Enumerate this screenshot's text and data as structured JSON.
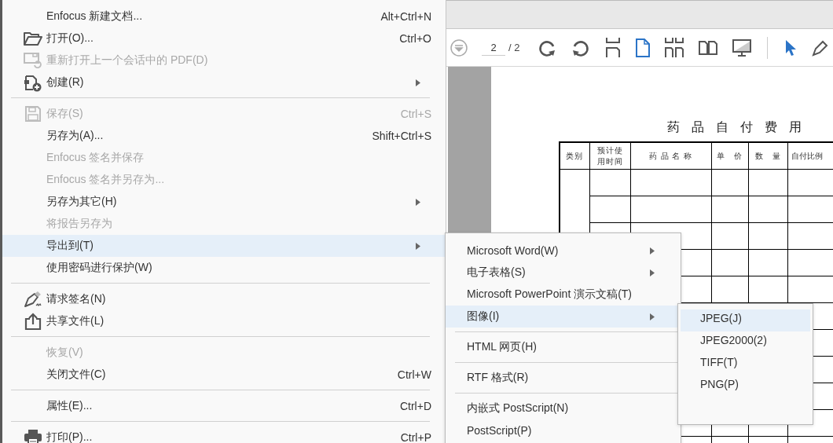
{
  "toolbar": {
    "tools": [
      {
        "kind": "scroll",
        "selected": false
      },
      {
        "kind": "page-field",
        "value": "2",
        "total": "/ 2"
      },
      {
        "kind": "rotate-cw",
        "selected": false
      },
      {
        "kind": "rotate-ccw",
        "selected": false
      },
      {
        "kind": "split",
        "selected": false
      },
      {
        "kind": "single-page",
        "selected": true
      },
      {
        "kind": "grid-pages",
        "selected": false
      },
      {
        "kind": "two-pages",
        "selected": false
      },
      {
        "kind": "monitor",
        "selected": false
      },
      {
        "kind": "divider"
      },
      {
        "kind": "cursor",
        "selected": true
      },
      {
        "kind": "pen",
        "selected": false
      }
    ]
  },
  "document": {
    "title": "药 品 自 付 费 用",
    "columns": [
      "类别",
      "预计使用时间",
      "药 品 名 称",
      "单　价",
      "数　量",
      "自付比例"
    ]
  },
  "file_menu": {
    "items": [
      {
        "kind": "item",
        "label": "Enfocus 新建文档...",
        "shortcut": "Alt+Ctrl+N",
        "disabled": false,
        "submenu": false,
        "selected": false
      },
      {
        "kind": "item",
        "label": "打开(O)...",
        "shortcut": "Ctrl+O",
        "disabled": false,
        "submenu": false,
        "selected": false
      },
      {
        "kind": "item",
        "label": "重新打开上一个会话中的 PDF(D)",
        "disabled": true,
        "submenu": false,
        "selected": false
      },
      {
        "kind": "item",
        "label": "创建(R)",
        "disabled": false,
        "submenu": true,
        "selected": false
      },
      {
        "kind": "separator"
      },
      {
        "kind": "item",
        "label": "保存(S)",
        "shortcut": "Ctrl+S",
        "disabled": true,
        "submenu": false,
        "selected": false
      },
      {
        "kind": "item",
        "label": "另存为(A)...",
        "shortcut": "Shift+Ctrl+S",
        "disabled": false,
        "submenu": false,
        "selected": false
      },
      {
        "kind": "item",
        "label": "Enfocus 签名并保存",
        "disabled": true,
        "submenu": false,
        "selected": false
      },
      {
        "kind": "item",
        "label": "Enfocus 签名并另存为...",
        "disabled": true,
        "submenu": false,
        "selected": false
      },
      {
        "kind": "item",
        "label": "另存为其它(H)",
        "disabled": false,
        "submenu": true,
        "selected": false
      },
      {
        "kind": "item",
        "label": "将报告另存为",
        "disabled": true,
        "submenu": false,
        "selected": false
      },
      {
        "kind": "item",
        "label": "导出到(T)",
        "disabled": false,
        "submenu": true,
        "selected": true
      },
      {
        "kind": "item",
        "label": "使用密码进行保护(W)",
        "disabled": false,
        "submenu": false,
        "selected": false
      },
      {
        "kind": "separator"
      },
      {
        "kind": "item",
        "label": "请求签名(N)",
        "disabled": false,
        "submenu": false,
        "selected": false
      },
      {
        "kind": "item",
        "label": "共享文件(L)",
        "disabled": false,
        "submenu": false,
        "selected": false
      },
      {
        "kind": "separator"
      },
      {
        "kind": "item",
        "label": "恢复(V)",
        "disabled": true,
        "submenu": false,
        "selected": false
      },
      {
        "kind": "item",
        "label": "关闭文件(C)",
        "shortcut": "Ctrl+W",
        "disabled": false,
        "submenu": false,
        "selected": false
      },
      {
        "kind": "separator"
      },
      {
        "kind": "item",
        "label": "属性(E)...",
        "shortcut": "Ctrl+D",
        "disabled": false,
        "submenu": false,
        "selected": false
      },
      {
        "kind": "separator"
      },
      {
        "kind": "item",
        "label": "打印(P)...",
        "shortcut": "Ctrl+P",
        "disabled": false,
        "submenu": false,
        "selected": false
      }
    ]
  },
  "export_menu": {
    "items": [
      {
        "kind": "item",
        "label": "Microsoft Word(W)",
        "submenu": true,
        "selected": false
      },
      {
        "kind": "item",
        "label": "电子表格(S)",
        "submenu": true,
        "selected": false
      },
      {
        "kind": "item",
        "label": "Microsoft PowerPoint 演示文稿(T)",
        "submenu": false,
        "selected": false
      },
      {
        "kind": "item",
        "label": "图像(I)",
        "submenu": true,
        "selected": true
      },
      {
        "kind": "separator"
      },
      {
        "kind": "item",
        "label": "HTML 网页(H)",
        "submenu": false,
        "selected": false
      },
      {
        "kind": "separator"
      },
      {
        "kind": "item",
        "label": "RTF 格式(R)",
        "submenu": false,
        "selected": false
      },
      {
        "kind": "separator"
      },
      {
        "kind": "item",
        "label": "内嵌式 PostScript(N)",
        "submenu": false,
        "selected": false
      },
      {
        "kind": "item",
        "label": "PostScript(P)",
        "submenu": false,
        "selected": false
      }
    ]
  },
  "image_menu": {
    "items": [
      {
        "label": "JPEG(J)",
        "selected": true
      },
      {
        "label": "JPEG2000(2)",
        "selected": false
      },
      {
        "label": "TIFF(T)",
        "selected": false
      },
      {
        "label": "PNG(P)",
        "selected": false
      }
    ]
  }
}
